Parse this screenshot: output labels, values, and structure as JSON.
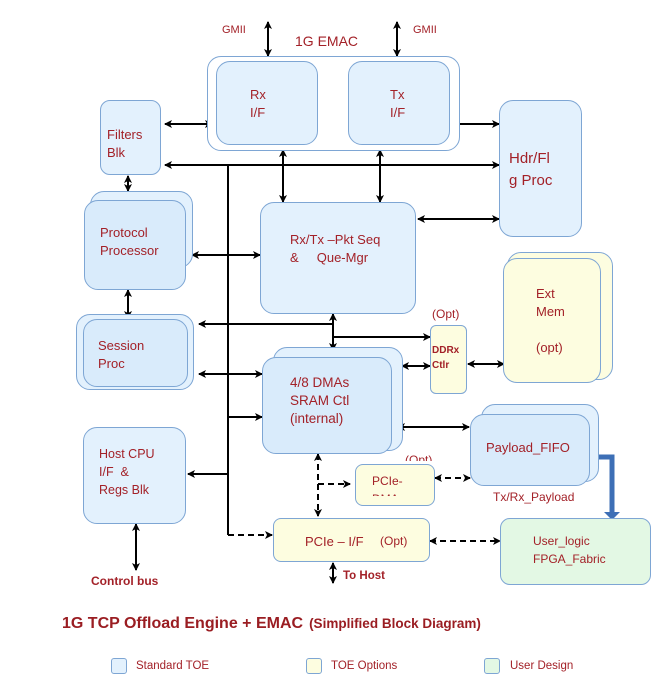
{
  "diagram": {
    "emac": {
      "title": "1G EMAC",
      "gmii_left": "GMII",
      "gmii_right": "GMII"
    },
    "blocks": {
      "rx_if": "Rx\nI/F",
      "tx_if": "Tx\nI/F",
      "filters": "Filters\nBlk",
      "hdr_proc": "Hdr/Fl\ng Proc",
      "protocol": "Protocol\nProcessor",
      "pkt_seq": "Rx/Tx –Pkt Seq\n&     Que-Mgr",
      "ext_mem": "Ext\nMem\n\n(opt)",
      "session": "Session\nProc",
      "ddr_opt": "(Opt)",
      "ddr": "DDRx\nCtlr",
      "dma": "4/8 DMAs\nSRAM Ctl\n(internal)",
      "payload_fifo": "Payload_FIFO",
      "payload_caption": "Tx/Rx_Payload",
      "host_cpu": "Host CPU\nI/F  &\nRegs Blk",
      "pcie_dma_opt": "(Opt)",
      "pcie_dma": "PCIe-\nDMA",
      "pcie_if": "PCIe – I/F",
      "pcie_if_opt": "(Opt)",
      "user_logic": "User_logic\nFPGA_Fabric",
      "control_bus": "Control bus",
      "to_host": "To Host"
    },
    "colors": {
      "standard_toe": "#e3f1fd",
      "toe_options": "#fdfde0",
      "user_design": "#e3f8e4",
      "border": "#7ea6d4",
      "label_text": "#a32128"
    }
  },
  "caption": {
    "title": "1G TCP Offload Engine + EMAC",
    "subtitle": "(Simplified Block Diagram)"
  },
  "legend": [
    {
      "label": "Standard TOE",
      "color": "#e3f1fd"
    },
    {
      "label": "TOE Options",
      "color": "#fdfde0"
    },
    {
      "label": "User Design",
      "color": "#e3f8e4"
    }
  ]
}
